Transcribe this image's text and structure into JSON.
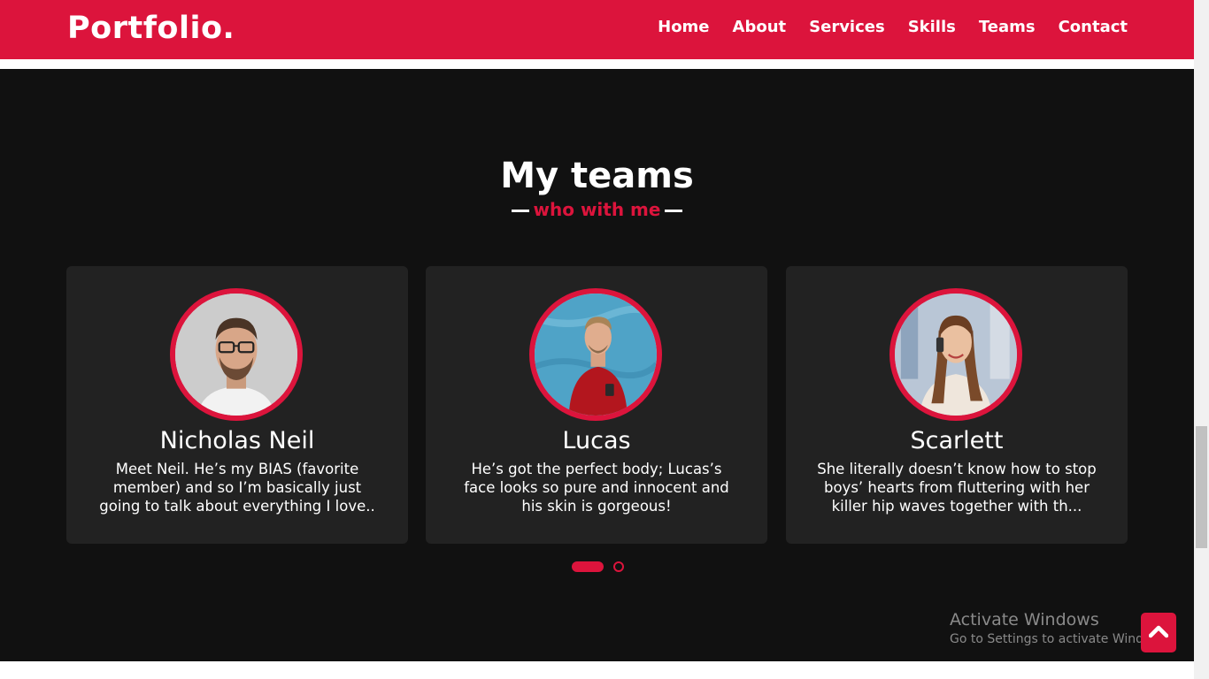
{
  "header": {
    "logo": "Portfolio.",
    "nav": [
      "Home",
      "About",
      "Services",
      "Skills",
      "Teams",
      "Contact"
    ]
  },
  "teams": {
    "title": "My teams",
    "subtitle": "who with me",
    "members": [
      {
        "name": "Nicholas Neil",
        "description": "Meet Neil. He’s my BIAS (favorite member) and so I’m basically just going to talk about everything I love..",
        "photo_icon": "man-glasses-photo"
      },
      {
        "name": "Lucas",
        "description": "He’s got the perfect body; Lucas’s face looks so pure and innocent and his skin is gorgeous!",
        "photo_icon": "man-red-sweater-photo"
      },
      {
        "name": "Scarlett",
        "description": "She literally doesn’t know how to stop boys’ hearts from fluttering with her killer hip waves together with th...",
        "photo_icon": "woman-phone-photo"
      }
    ],
    "carousel": {
      "active_page": 1,
      "pages": 2
    }
  },
  "os_watermark": {
    "line1": "Activate Windows",
    "line2": "Go to Settings to activate Windows."
  },
  "colors": {
    "accent": "#dc143c",
    "section_bg": "#111111",
    "card_bg": "#222222"
  }
}
